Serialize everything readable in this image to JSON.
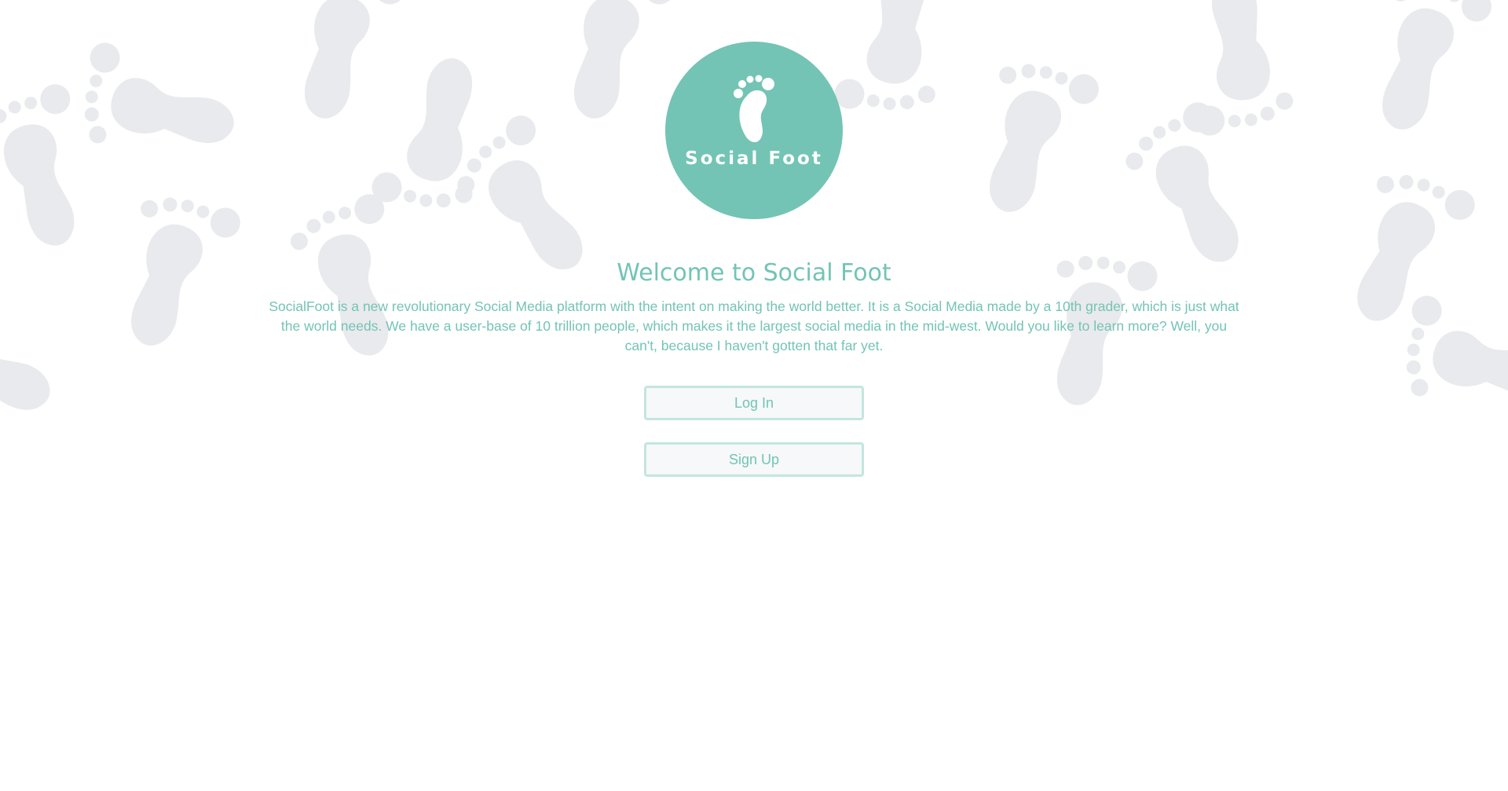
{
  "colors": {
    "accent": "#73c4b5",
    "button_border": "#c3e6df",
    "button_bg": "#f6f8f9",
    "background_pattern": "#e9eaed",
    "page_background": "#ffffff"
  },
  "logo": {
    "icon": "footprint-icon",
    "text": "Social Foot"
  },
  "hero": {
    "title": "Welcome to Social Foot",
    "description": "SocialFoot is a new revolutionary Social Media platform with the intent on making the world better. It is a Social Media made by a 10th grader, which is just what the world needs. We have a user-base of 10 trillion people, which makes it the largest social media in the mid-west. Would you like to learn more? Well, you can't, because I haven't gotten that far yet."
  },
  "actions": {
    "login_label": "Log In",
    "signup_label": "Sign Up"
  },
  "background": {
    "pattern_icon": "footprint-icon"
  }
}
